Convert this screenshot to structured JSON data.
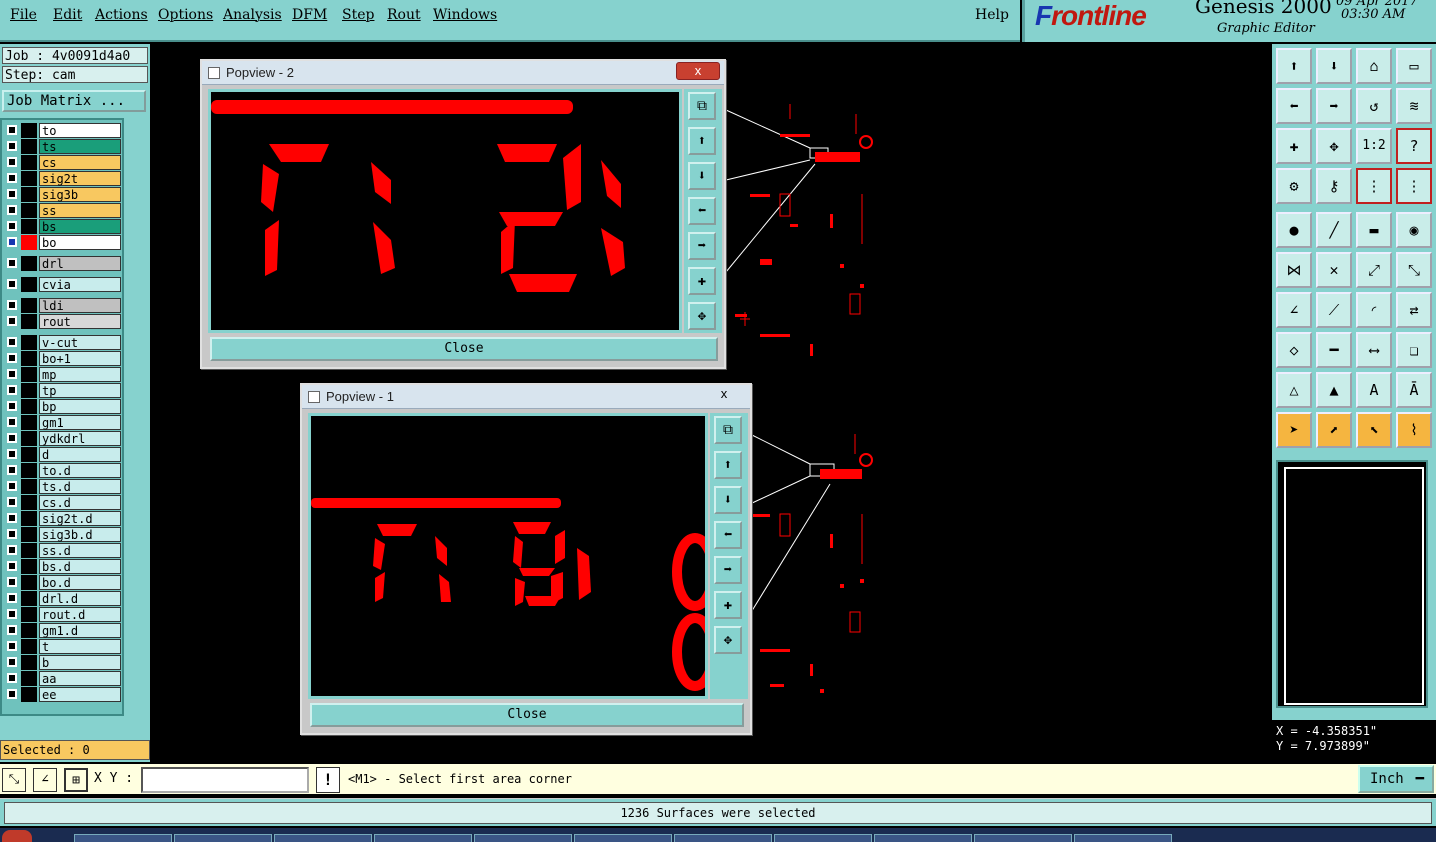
{
  "menu": [
    "File",
    "Edit",
    "Actions",
    "Options",
    "Analysis",
    "DFM",
    "Step",
    "Rout",
    "Windows"
  ],
  "help_label": "Help",
  "brand": {
    "logo_prefix": "F",
    "logo_text": "rontline",
    "product": "Genesis 2000",
    "subtitle": "Graphic Editor",
    "date": "09 Apr 2017",
    "time": "03:30 AM"
  },
  "job": {
    "job_label": "Job : 4v0091d4a0",
    "step_label": "Step: cam",
    "job_matrix_button": "Job Matrix ..."
  },
  "layers": [
    {
      "name": "to",
      "color": "#ffffff"
    },
    {
      "name": "ts",
      "color": "#1a9e7a"
    },
    {
      "name": "cs",
      "color": "#f8c860"
    },
    {
      "name": "sig2t",
      "color": "#f8c860"
    },
    {
      "name": "sig3b",
      "color": "#f8c860"
    },
    {
      "name": "ss",
      "color": "#f8c860"
    },
    {
      "name": "bs",
      "color": "#1a9e7a"
    },
    {
      "name": "bo",
      "color": "#ffffff"
    },
    {
      "name": "drl",
      "color": "#c0c0c0"
    },
    {
      "name": "cvia",
      "color": "#c8ecec"
    },
    {
      "name": "ldi",
      "color": "#c0c0c0"
    },
    {
      "name": "rout",
      "color": "#d8d8d8"
    },
    {
      "name": "v-cut",
      "color": "#c8ecec"
    },
    {
      "name": "bo+1",
      "color": "#c8ecec"
    },
    {
      "name": "mp",
      "color": "#c8ecec"
    },
    {
      "name": "tp",
      "color": "#c8ecec"
    },
    {
      "name": "bp",
      "color": "#c8ecec"
    },
    {
      "name": "gm1",
      "color": "#c8ecec"
    },
    {
      "name": "ydkdrl",
      "color": "#c8ecec"
    },
    {
      "name": "d",
      "color": "#c8ecec"
    },
    {
      "name": "to.d",
      "color": "#c8ecec"
    },
    {
      "name": "ts.d",
      "color": "#c8ecec"
    },
    {
      "name": "cs.d",
      "color": "#c8ecec"
    },
    {
      "name": "sig2t.d",
      "color": "#c8ecec"
    },
    {
      "name": "sig3b.d",
      "color": "#c8ecec"
    },
    {
      "name": "ss.d",
      "color": "#c8ecec"
    },
    {
      "name": "bs.d",
      "color": "#c8ecec"
    },
    {
      "name": "bo.d",
      "color": "#c8ecec"
    },
    {
      "name": "drl.d",
      "color": "#c8ecec"
    },
    {
      "name": "rout.d",
      "color": "#c8ecec"
    },
    {
      "name": "gm1.d",
      "color": "#c8ecec"
    },
    {
      "name": "t",
      "color": "#c8ecec"
    },
    {
      "name": "b",
      "color": "#c8ecec"
    },
    {
      "name": "aa",
      "color": "#c8ecec"
    },
    {
      "name": "ee",
      "color": "#c8ecec"
    }
  ],
  "selected_label": "Selected : 0",
  "popview2": {
    "title": "Popview - 2",
    "close_label": "Close",
    "x_label": "x"
  },
  "popview1": {
    "title": "Popview - 1",
    "close_label": "Close",
    "x_label": "x"
  },
  "coords": {
    "x": "X = -4.358351\"",
    "y": "Y = 7.973899\""
  },
  "cmd": {
    "xy_label": "X Y :",
    "xy_value": "",
    "excl": "!",
    "prompt": "<M1> - Select first area corner",
    "unit": "Inch"
  },
  "status": "1236 Surfaces were selected",
  "colors": {
    "accent": "#86d2ce",
    "pcb_red": "#ff0000",
    "brand_red": "#c01810",
    "brand_blue": "#1836b0"
  }
}
